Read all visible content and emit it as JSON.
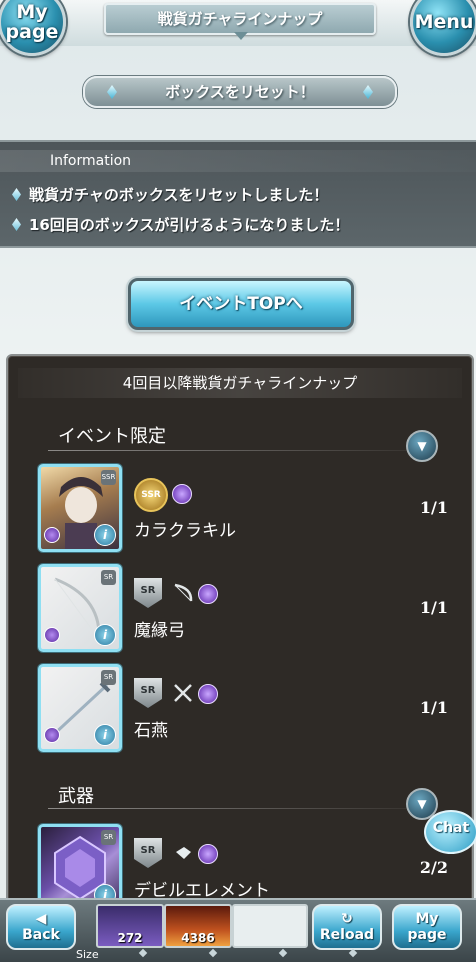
{
  "header": {
    "mypage_line1": "My",
    "mypage_line2": "page",
    "title": "戦貨ガチャラインナップ",
    "menu_label": "Menu"
  },
  "reset_button": "ボックスをリセット！",
  "information": {
    "title": "Information",
    "lines": [
      "戦貨ガチャのボックスをリセットしました！",
      "16回目のボックスが引けるようになりました！"
    ]
  },
  "event_top_button": "イベントTOPへ",
  "lineup": {
    "heading": "4回目以降戦貨ガチャラインナップ",
    "sections": [
      {
        "label": "イベント限定",
        "items": [
          {
            "name": "カラクラキル",
            "count": "1/1",
            "rarity": "SSR",
            "thumb_rarity": "SSR",
            "icon": "character-portrait-icon"
          },
          {
            "name": "魔縁弓",
            "count": "1/1",
            "rarity": "SR",
            "thumb_rarity": "SR",
            "icon": "bow-icon"
          },
          {
            "name": "石燕",
            "count": "1/1",
            "rarity": "SR",
            "thumb_rarity": "SR",
            "icon": "sword-icon"
          }
        ]
      },
      {
        "label": "武器",
        "items": [
          {
            "name": "デビルエレメント",
            "count": "2/2",
            "rarity": "SR",
            "thumb_rarity": "SR",
            "icon": "gem-icon"
          }
        ]
      }
    ]
  },
  "chat_label": "Chat",
  "footer": {
    "back_label": "Back",
    "reload_label": "Reload",
    "mypage_line1": "My",
    "mypage_line2": "page",
    "currency1": "272",
    "currency2": "4386",
    "size_label": "Size"
  },
  "colors": {
    "accent": "#5cc8e6",
    "panel_dark": "#2e2a26",
    "info_bg": "#4d5559"
  }
}
